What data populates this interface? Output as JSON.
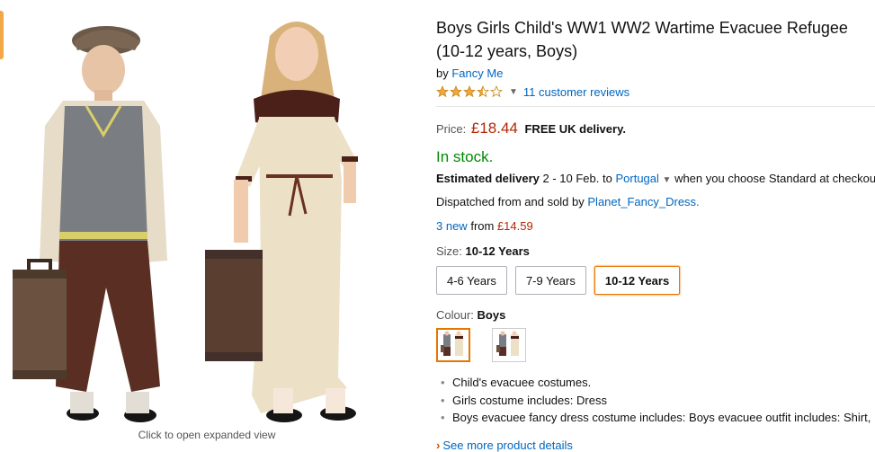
{
  "image": {
    "caption": "Click to open expanded view"
  },
  "product": {
    "title_line1": "Boys Girls Child's WW1 WW2 Wartime Evacuee Refugee",
    "title_line2": "(10-12 years, Boys)",
    "by_prefix": "by",
    "brand": "Fancy Me",
    "rating": 3.5,
    "reviews_link": "11 customer reviews"
  },
  "price": {
    "label": "Price:",
    "amount": "£18.44",
    "delivery_note": "FREE UK delivery."
  },
  "availability": {
    "stock": "In stock.",
    "delivery_label": "Estimated delivery",
    "delivery_dates": "2 - 10 Feb.",
    "delivery_to": "to",
    "country": "Portugal",
    "delivery_suffix": "when you choose Standard at checkout",
    "dispatched_prefix": "Dispatched from and sold by",
    "seller": "Planet_Fancy_Dress."
  },
  "offers": {
    "new_count": "3 new",
    "from_text": "from",
    "from_price": "£14.59"
  },
  "size": {
    "label": "Size:",
    "selected": "10-12 Years",
    "options": [
      "4-6 Years",
      "7-9 Years",
      "10-12 Years"
    ]
  },
  "colour": {
    "label": "Colour:",
    "selected": "Boys"
  },
  "bullets": [
    "Child's evacuee costumes.",
    "Girls costume includes: Dress",
    "Boys evacuee fancy dress costume includes: Boys evacuee outfit includes: Shirt,"
  ],
  "see_more": "See more product details",
  "colors": {
    "link": "#0066c0",
    "price": "#b12704",
    "in_stock": "#008a00",
    "selected_border": "#e77600",
    "star": "#f0a83a"
  }
}
